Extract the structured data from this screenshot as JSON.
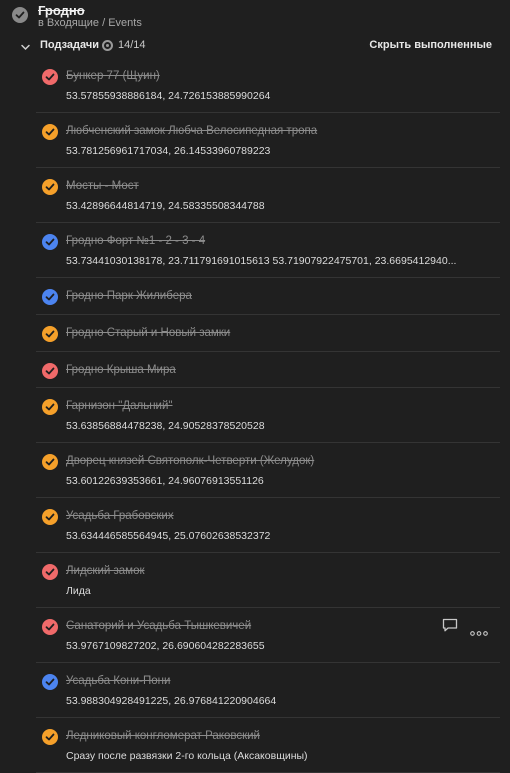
{
  "header": {
    "title": "Гродно",
    "breadcrumb": "в Входящие / Events"
  },
  "subtasks": {
    "label": "Подзадачи",
    "count": "14/14",
    "hide_label": "Скрыть выполненные"
  },
  "colors": {
    "red": "#f06a6a",
    "orange": "#f5a02a",
    "blue": "#4c84f0",
    "gray": "#8a8a8a"
  },
  "items": [
    {
      "title": "Бункер 77 (Щуин)",
      "desc": "53.57855938886184, 24.726153885990264",
      "color": "red"
    },
    {
      "title": "Любченский замок Любча Велосипедная тропа",
      "desc": "53.781256961717034, 26.14533960789223",
      "color": "orange"
    },
    {
      "title": "Мосты - Мост",
      "desc": "53.42896644814719, 24.58335508344788",
      "color": "orange"
    },
    {
      "title": "Гродно Форт №1 - 2 - 3 - 4",
      "desc": "53.73441030138178, 23.711791691015613 53.71907922475701, 23.6695412940...",
      "color": "blue"
    },
    {
      "title": "Гродно Парк Жилибера",
      "desc": "",
      "color": "blue"
    },
    {
      "title": "Гродно Старый и Новый замки",
      "desc": "",
      "color": "orange"
    },
    {
      "title": "Гродно Крыша Мира",
      "desc": "",
      "color": "red"
    },
    {
      "title": "Гарнизон \"Дальний\"",
      "desc": "53.63856884478238, 24.90528378520528",
      "color": "orange"
    },
    {
      "title": "Дворец князей Святополк-Четверти (Желудок)",
      "desc": "53.60122639353661, 24.96076913551126",
      "color": "orange"
    },
    {
      "title": "Усадьба Грабовских",
      "desc": "53.634446585564945, 25.07602638532372",
      "color": "orange"
    },
    {
      "title": "Лидский замок",
      "desc": "Лида",
      "color": "red"
    },
    {
      "title": "Санаторий и Усадьба Тышкевичей",
      "desc": "53.9767109827202, 26.690604282283655",
      "color": "red"
    },
    {
      "title": "Усадьба Кони-Пони",
      "desc": "53.988304928491225, 26.976841220904664",
      "color": "blue"
    },
    {
      "title": "Ледниковый конгломерат Раковский",
      "desc": "Сразу после развязки 2-го кольца (Аксаковщины)",
      "color": "orange"
    }
  ]
}
